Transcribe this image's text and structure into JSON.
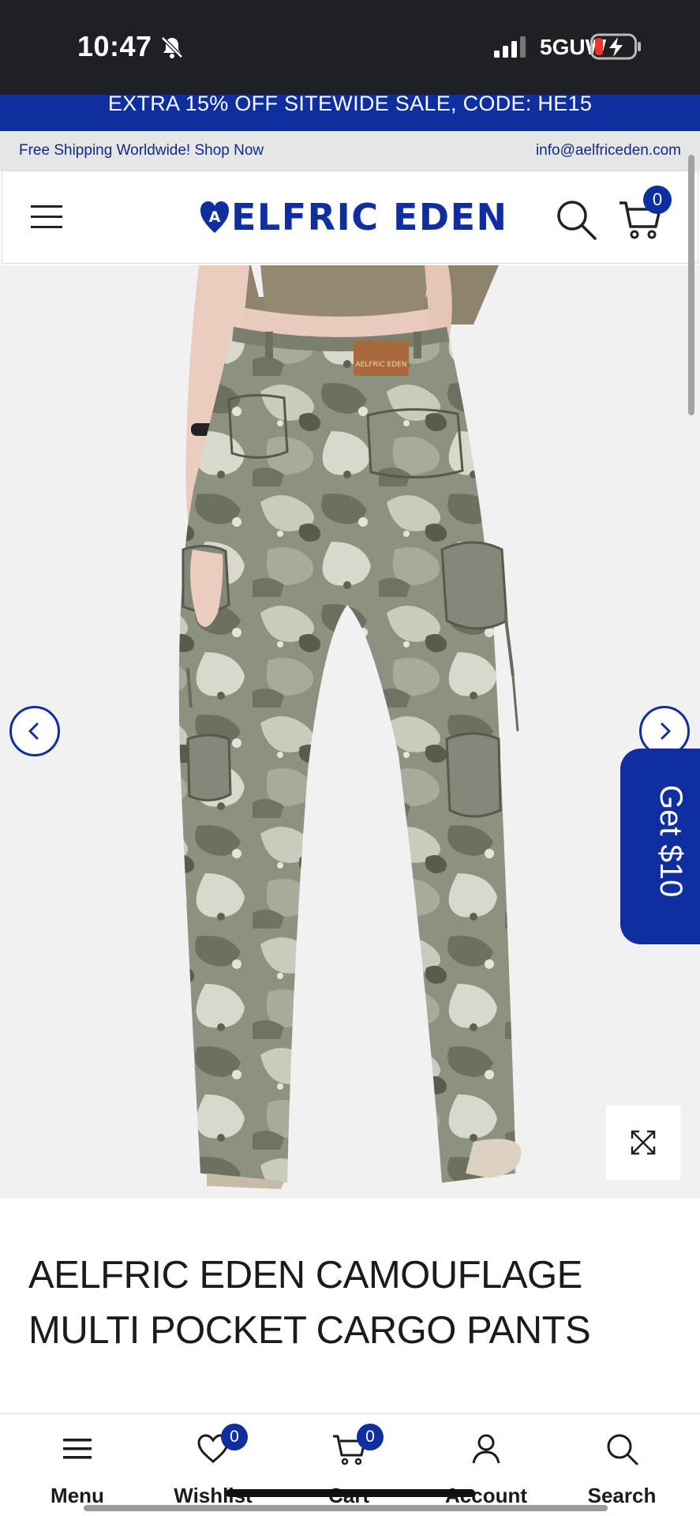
{
  "status_bar": {
    "time": "10:47",
    "network": "5GUW",
    "icons": [
      "bell-muted-icon",
      "signal-icon",
      "battery-charging-icon"
    ]
  },
  "promo_banner": {
    "text": "EXTRA 15% OFF SITEWIDE SALE, CODE: HE15"
  },
  "info_strip": {
    "left": "Free Shipping Worldwide! Shop Now",
    "right": "info@aelfriceden.com"
  },
  "header": {
    "logo_text": "ELFRIC EDEN",
    "logo_letter": "A",
    "cart_count": "0",
    "icons": [
      "menu-icon",
      "search-icon",
      "cart-icon"
    ]
  },
  "gallery": {
    "icons": [
      "chevron-left-icon",
      "chevron-right-icon",
      "expand-icon"
    ],
    "promo_tab": "Get $10",
    "brand_patch": "AELFRIC EDEN"
  },
  "product": {
    "title_line1": "AELFRIC EDEN CAMOUFLAGE",
    "title_line2": "MULTI POCKET CARGO PANTS"
  },
  "bottom_nav": {
    "items": [
      {
        "label": "Menu",
        "icon": "menu-icon"
      },
      {
        "label": "Wishlist",
        "icon": "heart-icon",
        "badge": "0"
      },
      {
        "label": "Cart",
        "icon": "cart-icon",
        "badge": "0"
      },
      {
        "label": "Account",
        "icon": "user-icon"
      },
      {
        "label": "Search",
        "icon": "search-icon"
      }
    ]
  },
  "colors": {
    "brand_blue": "#0f2ea0",
    "status_bar": "#1f2024",
    "info_strip_bg": "#e6e6e6"
  }
}
